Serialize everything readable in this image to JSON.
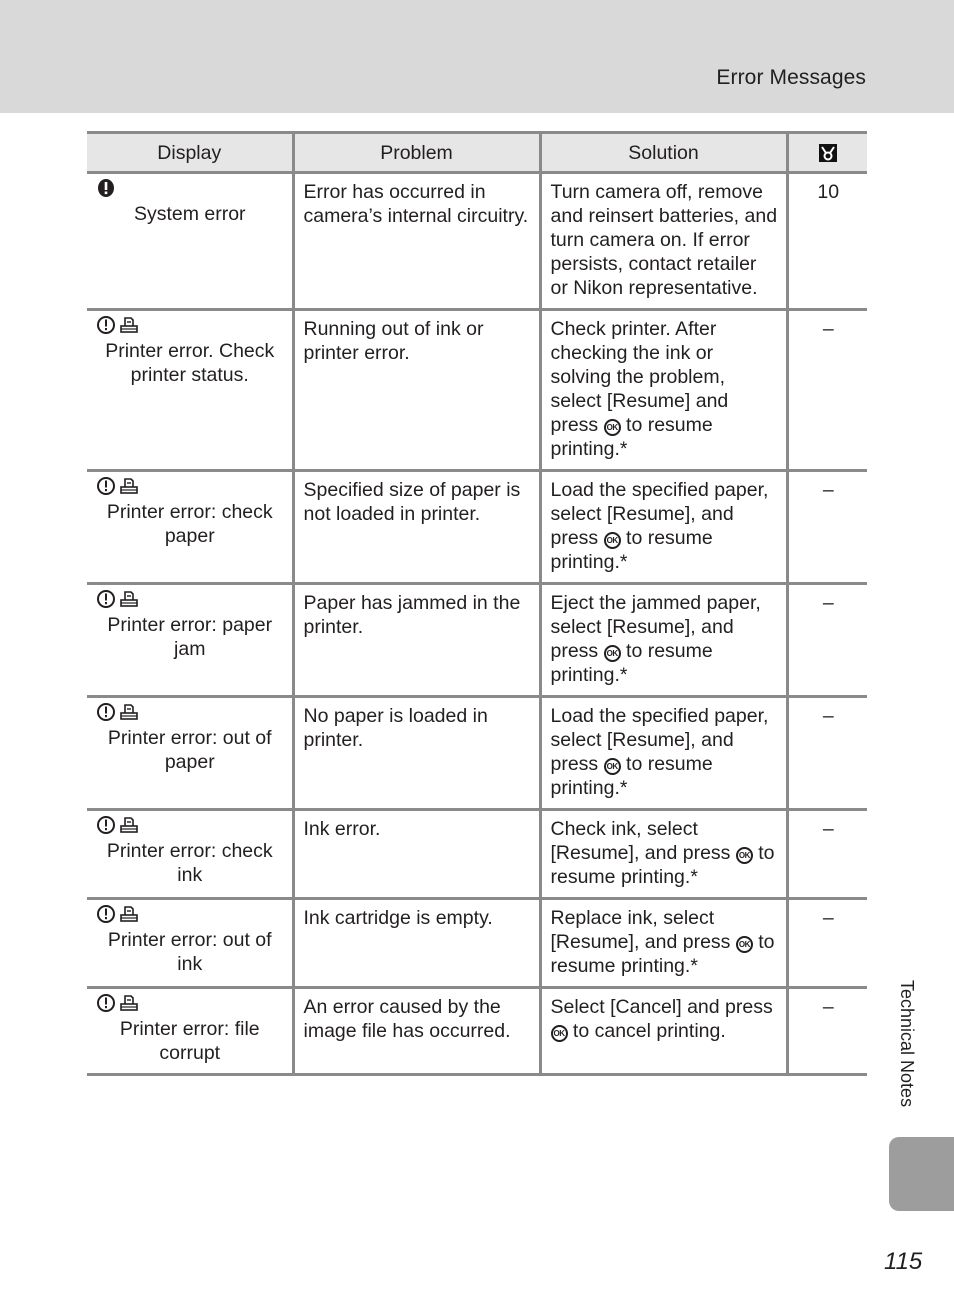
{
  "header": {
    "section_title": "Error Messages"
  },
  "table": {
    "columns": [
      "Display",
      "Problem",
      "Solution",
      "reference-page-icon"
    ],
    "ok_label": "OK",
    "rows": [
      {
        "icons": [
          "system-error-icon"
        ],
        "display": "System error",
        "problem": "Error has occurred in camera’s internal circuitry.",
        "solution": "Turn camera off, remove and reinsert batteries, and turn camera on. If error persists, contact retailer or Nikon representative.",
        "ref": "10"
      },
      {
        "icons": [
          "warning-icon",
          "printer-icon"
        ],
        "display": "Printer error. Check printer status.",
        "problem": "Running out of ink or printer error.",
        "solution_before": "Check printer. After checking the ink or solving the problem, select [Resume] and press",
        "solution_after": "to resume printing.*",
        "ref": "–"
      },
      {
        "icons": [
          "warning-icon",
          "printer-icon"
        ],
        "display": "Printer error: check paper",
        "problem": "Specified size of paper is not loaded in printer.",
        "solution_before": "Load the specified paper, select [Resume], and press",
        "solution_after": "to resume printing.*",
        "ref": "–"
      },
      {
        "icons": [
          "warning-icon",
          "printer-icon"
        ],
        "display": "Printer error: paper jam",
        "problem": "Paper has jammed in the printer.",
        "solution_before": "Eject the jammed paper, select [Resume], and press",
        "solution_after": "to resume printing.*",
        "ref": "–"
      },
      {
        "icons": [
          "warning-icon",
          "printer-icon"
        ],
        "display": "Printer error: out of paper",
        "problem": "No paper is loaded in printer.",
        "solution_before": "Load the specified paper, select [Resume], and press",
        "solution_after": "to resume printing.*",
        "ref": "–"
      },
      {
        "icons": [
          "warning-icon",
          "printer-icon"
        ],
        "display": "Printer error: check ink",
        "problem": "Ink error.",
        "solution_before": "Check ink, select [Resume], and press",
        "solution_after": "to resume printing.*",
        "ref": "–"
      },
      {
        "icons": [
          "warning-icon",
          "printer-icon"
        ],
        "display": "Printer error: out of ink",
        "problem": "Ink cartridge is empty.",
        "solution_before": "Replace ink, select [Resume], and press",
        "solution_after": "to resume printing.*",
        "ref": "–"
      },
      {
        "icons": [
          "warning-icon",
          "printer-icon"
        ],
        "display": "Printer error: file corrupt",
        "problem": "An error caused by the image file has occurred.",
        "solution_before": "Select [Cancel] and press",
        "solution_after": "to cancel printing.",
        "ref": "–"
      }
    ]
  },
  "side": {
    "label": "Technical Notes"
  },
  "footer": {
    "page_number": "115"
  }
}
